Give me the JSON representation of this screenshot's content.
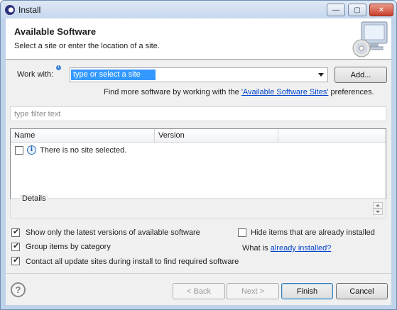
{
  "window": {
    "title": "Install"
  },
  "banner": {
    "title": "Available Software",
    "subtitle": "Select a site or enter the location of a site."
  },
  "work_with": {
    "label": "Work with:",
    "value": "type or select a site",
    "add_label": "Add..."
  },
  "find_more": {
    "prefix": "Find more software by working with the ",
    "link": "'Available Software Sites'",
    "suffix": " preferences."
  },
  "filter": {
    "placeholder": "type filter text"
  },
  "table": {
    "columns": [
      "Name",
      "Version"
    ],
    "rows": [
      {
        "name": "There is no site selected.",
        "checked": false
      }
    ]
  },
  "details": {
    "label": "Details"
  },
  "options": {
    "latest_versions": {
      "label": "Show only the latest versions of available software",
      "checked": true
    },
    "hide_installed": {
      "label": "Hide items that are already installed",
      "checked": false
    },
    "group_by_category": {
      "label": "Group items by category",
      "checked": true
    },
    "what_is_prefix": "What is ",
    "already_installed_link": "already installed?",
    "contact_sites": {
      "label": "Contact all update sites during install to find required software",
      "checked": true
    }
  },
  "buttons": {
    "back": "< Back",
    "next": "Next >",
    "finish": "Finish",
    "cancel": "Cancel"
  },
  "icons": {
    "help": "help-icon",
    "info": "info-icon",
    "app": "eclipse-icon",
    "banner": "install-monitor-icon"
  }
}
